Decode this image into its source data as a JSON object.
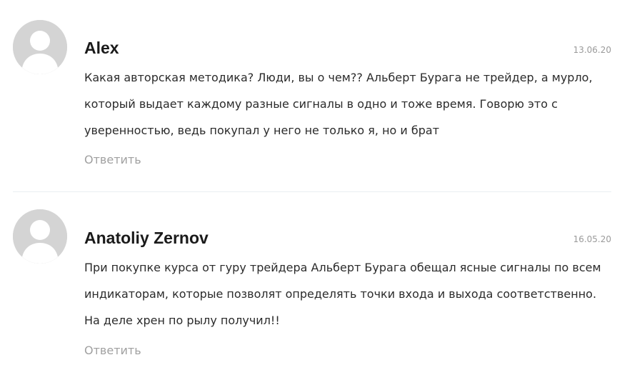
{
  "comments": [
    {
      "author": "Alex",
      "date": "13.06.20",
      "text": "Какая авторская методика? Люди, вы о чем?? Альберт Бурага не трейдер, а мурло, который выдает каждому разные сигналы в одно и тоже время. Говорю это с уверенностью, ведь покупал у него не только я, но и брат",
      "reply_label": "Ответить",
      "avatar_icon": "user-placeholder-icon"
    },
    {
      "author": "Anatoliy Zernov",
      "date": "16.05.20",
      "text": "При покупке курса от гуру трейдера Альберт Бурага обещал ясные сигналы по всем индикаторам, которые позволят определять точки входа и выхода соответственно. На деле хрен по рылу получил!!",
      "reply_label": "Ответить",
      "avatar_icon": "user-placeholder-icon"
    }
  ],
  "colors": {
    "avatar_bg": "#d4d4d4",
    "avatar_fg": "#ffffff",
    "author": "#1a1a1a",
    "text": "#2b2b2b",
    "muted": "#a0a0a0",
    "divider": "#e9eff1"
  }
}
